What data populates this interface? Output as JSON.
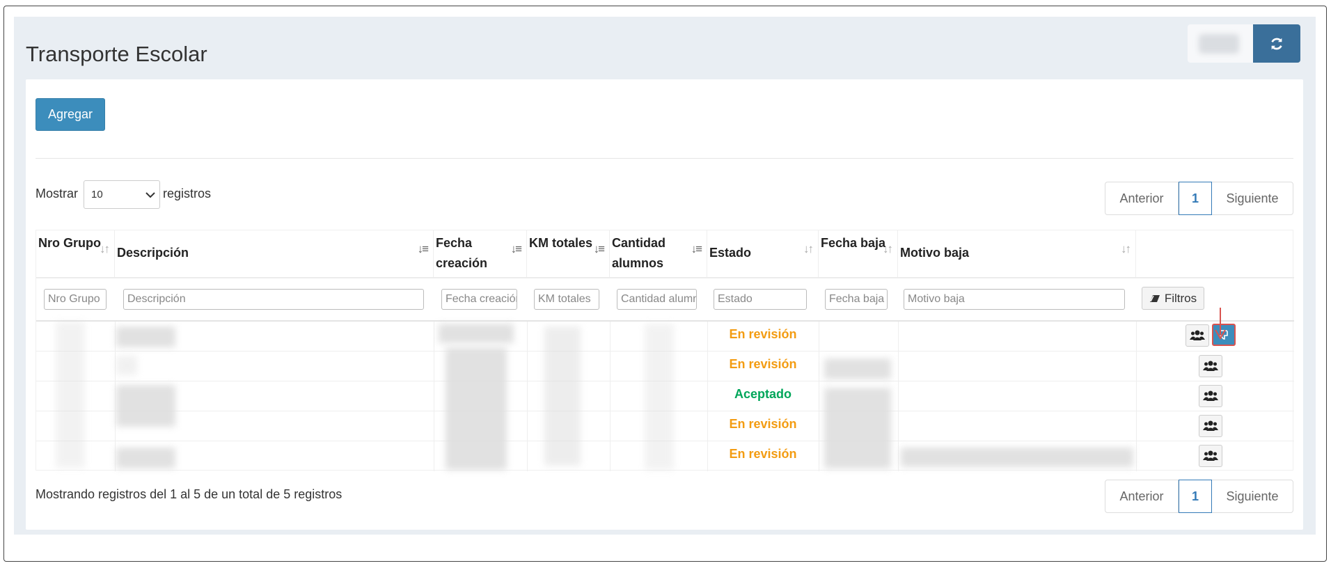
{
  "page": {
    "title": "Transporte Escolar"
  },
  "toolbar": {
    "add_label": "Agregar"
  },
  "length_menu": {
    "prefix": "Mostrar",
    "selected": "10",
    "suffix": "registros"
  },
  "pagination": {
    "prev": "Anterior",
    "current": "1",
    "next": "Siguiente"
  },
  "table": {
    "columns": [
      {
        "label": "Nro Grupo",
        "filter_placeholder": "Nro Grupo"
      },
      {
        "label": "Descripción",
        "filter_placeholder": "Descripción"
      },
      {
        "label": "Fecha creación",
        "filter_placeholder": "Fecha creación"
      },
      {
        "label": "KM totales",
        "filter_placeholder": "KM totales"
      },
      {
        "label": "Cantidad alumnos",
        "filter_placeholder": "Cantidad alumnos"
      },
      {
        "label": "Estado",
        "filter_placeholder": "Estado"
      },
      {
        "label": "Fecha baja",
        "filter_placeholder": "Fecha baja"
      },
      {
        "label": "Motivo baja",
        "filter_placeholder": "Motivo baja"
      }
    ],
    "filters_button": "Filtros",
    "rows": [
      {
        "estado": "En revisión",
        "estado_color": "#f39c12"
      },
      {
        "estado": "En revisión",
        "estado_color": "#f39c12"
      },
      {
        "estado": "Aceptado",
        "estado_color": "#00a65a"
      },
      {
        "estado": "En revisión",
        "estado_color": "#f39c12"
      },
      {
        "estado": "En revisión",
        "estado_color": "#f39c12"
      }
    ]
  },
  "footer": {
    "info": "Mostrando registros del 1 al 5 de un total de 5 registros"
  },
  "icons": {
    "refresh": "refresh-icon",
    "users": "users-icon",
    "thumbs_down": "thumbs-down-icon",
    "eraser": "eraser-icon",
    "sort": "sort-icon",
    "arrow": "arrow-down-icon"
  },
  "colors": {
    "primary": "#3c8dbc",
    "refresh_button": "#3a6f9a",
    "warning": "#f39c12",
    "success": "#00a65a",
    "highlight_border": "#d9534f"
  }
}
